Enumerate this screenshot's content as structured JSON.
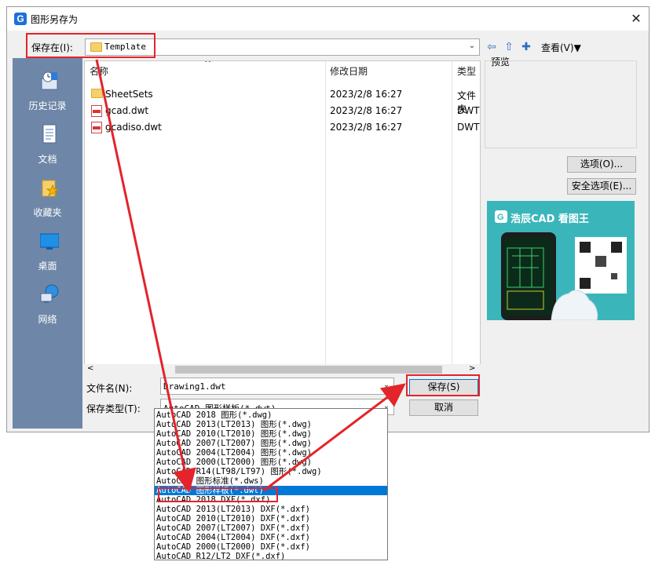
{
  "window": {
    "title": "图形另存为",
    "close_glyph": "✕"
  },
  "toolbar": {
    "save_in_label": "保存在(I):",
    "save_in_value": "Template",
    "view_label": "查看(V)",
    "view_arrow": "▼",
    "back_glyph": "⇦",
    "up_glyph": "⇧",
    "newfolder_glyph": "✚"
  },
  "places": [
    {
      "label": "历史记录",
      "icon": "history-icon"
    },
    {
      "label": "文档",
      "icon": "documents-icon"
    },
    {
      "label": "收藏夹",
      "icon": "favorites-icon"
    },
    {
      "label": "桌面",
      "icon": "desktop-icon"
    },
    {
      "label": "网络",
      "icon": "network-icon"
    }
  ],
  "file_list": {
    "columns": [
      "名称",
      "修改日期",
      "类型"
    ],
    "sort_glyph": "^",
    "rows": [
      {
        "name": "SheetSets",
        "date": "2023/2/8 16:27",
        "type": "文件夹",
        "kind": "folder"
      },
      {
        "name": "gcad.dwt",
        "date": "2023/2/8 16:27",
        "type": "DWT",
        "kind": "dwt"
      },
      {
        "name": "gcadiso.dwt",
        "date": "2023/2/8 16:27",
        "type": "DWT",
        "kind": "dwt"
      }
    ]
  },
  "scroll": {
    "left_glyph": "<",
    "right_glyph": ">"
  },
  "preview": {
    "label": "预览"
  },
  "buttons": {
    "options": "选项(O)...",
    "security": "安全选项(E)...",
    "save": "保存(S)",
    "cancel": "取消"
  },
  "ad": {
    "brand": "浩辰CAD 看图王"
  },
  "filename": {
    "label": "文件名(N):",
    "value": "Drawing1.dwt"
  },
  "filetype": {
    "label": "保存类型(T):",
    "value": "AutoCAD 图形样板(*.dwt)",
    "options": [
      "AutoCAD 2018 图形(*.dwg)",
      "AutoCAD 2013(LT2013) 图形(*.dwg)",
      "AutoCAD 2010(LT2010) 图形(*.dwg)",
      "AutoCAD 2007(LT2007) 图形(*.dwg)",
      "AutoCAD 2004(LT2004) 图形(*.dwg)",
      "AutoCAD 2000(LT2000) 图形(*.dwg)",
      "AutoCAD R14(LT98/LT97) 图形(*.dwg)",
      "AutoCAD 图形标准(*.dws)",
      "AutoCAD 图形样板(*.dwt)",
      "AutoCAD 2018 DXF(*.dxf)",
      "AutoCAD 2013(LT2013) DXF(*.dxf)",
      "AutoCAD 2010(LT2010) DXF(*.dxf)",
      "AutoCAD 2007(LT2007) DXF(*.dxf)",
      "AutoCAD 2004(LT2004) DXF(*.dxf)",
      "AutoCAD 2000(LT2000) DXF(*.dxf)",
      "AutoCAD R12/LT2 DXF(*.dxf)"
    ],
    "selected_index": 8
  },
  "colors": {
    "annotation_red": "#e3242b",
    "selection_blue": "#0078d7",
    "places_bg": "#6e87a8"
  }
}
